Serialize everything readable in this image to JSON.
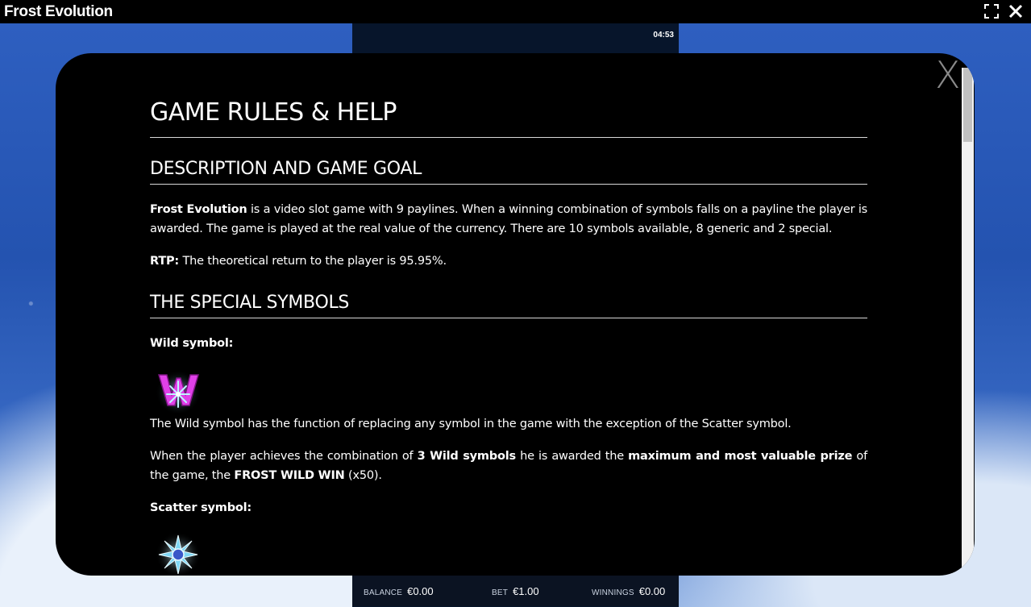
{
  "app": {
    "title": "Frost Evolution"
  },
  "game": {
    "timer": "04:53"
  },
  "bottom_bar": {
    "balance_label": "BALANCE",
    "balance_value": "€0.00",
    "bet_label": "BET",
    "bet_value": "€1.00",
    "winnings_label": "WINNINGS",
    "winnings_value": "€0.00"
  },
  "modal": {
    "close_label": "X",
    "title": "GAME RULES & HELP",
    "section1": {
      "heading": "DESCRIPTION AND GAME GOAL",
      "p1_bold": "Frost Evolution",
      "p1_rest": " is a video slot game with 9 paylines. When a winning combination of symbols falls on a payline the player is awarded. The game is played at the real value of the currency. There are 10 symbols available, 8 generic and 2 special.",
      "rtp_label": "RTP:",
      "rtp_text": " The theoretical return to the player is 95.95%."
    },
    "section2": {
      "heading": "THE SPECIAL SYMBOLS",
      "wild_title": "Wild symbol:",
      "wild_desc": "The Wild symbol has the function of replacing any symbol in the game with the exception of the Scatter symbol.",
      "wild_p2_a": "When the player achieves the combination of ",
      "wild_p2_b": "3 Wild symbols",
      "wild_p2_c": " he is awarded the ",
      "wild_p2_d": "maximum and most valuable prize",
      "wild_p2_e": " of the game, the ",
      "wild_p2_f": "FROST WILD WIN",
      "wild_p2_g": " (x50).",
      "scatter_title": "Scatter symbol:"
    }
  }
}
